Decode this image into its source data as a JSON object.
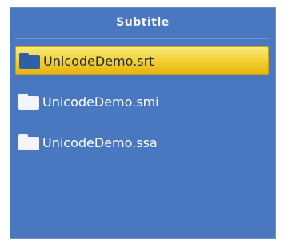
{
  "dialog": {
    "title": "Subtitle"
  },
  "files": [
    {
      "name": "UnicodeDemo.srt",
      "icon": "folder-icon",
      "selected": true
    },
    {
      "name": "UnicodeDemo.smi",
      "icon": "folder-icon",
      "selected": false
    },
    {
      "name": "UnicodeDemo.ssa",
      "icon": "folder-icon",
      "selected": false
    }
  ],
  "colors": {
    "panel_background": "#4a78c0",
    "selection_highlight": "#f3d43a",
    "text": "#ffffff"
  }
}
